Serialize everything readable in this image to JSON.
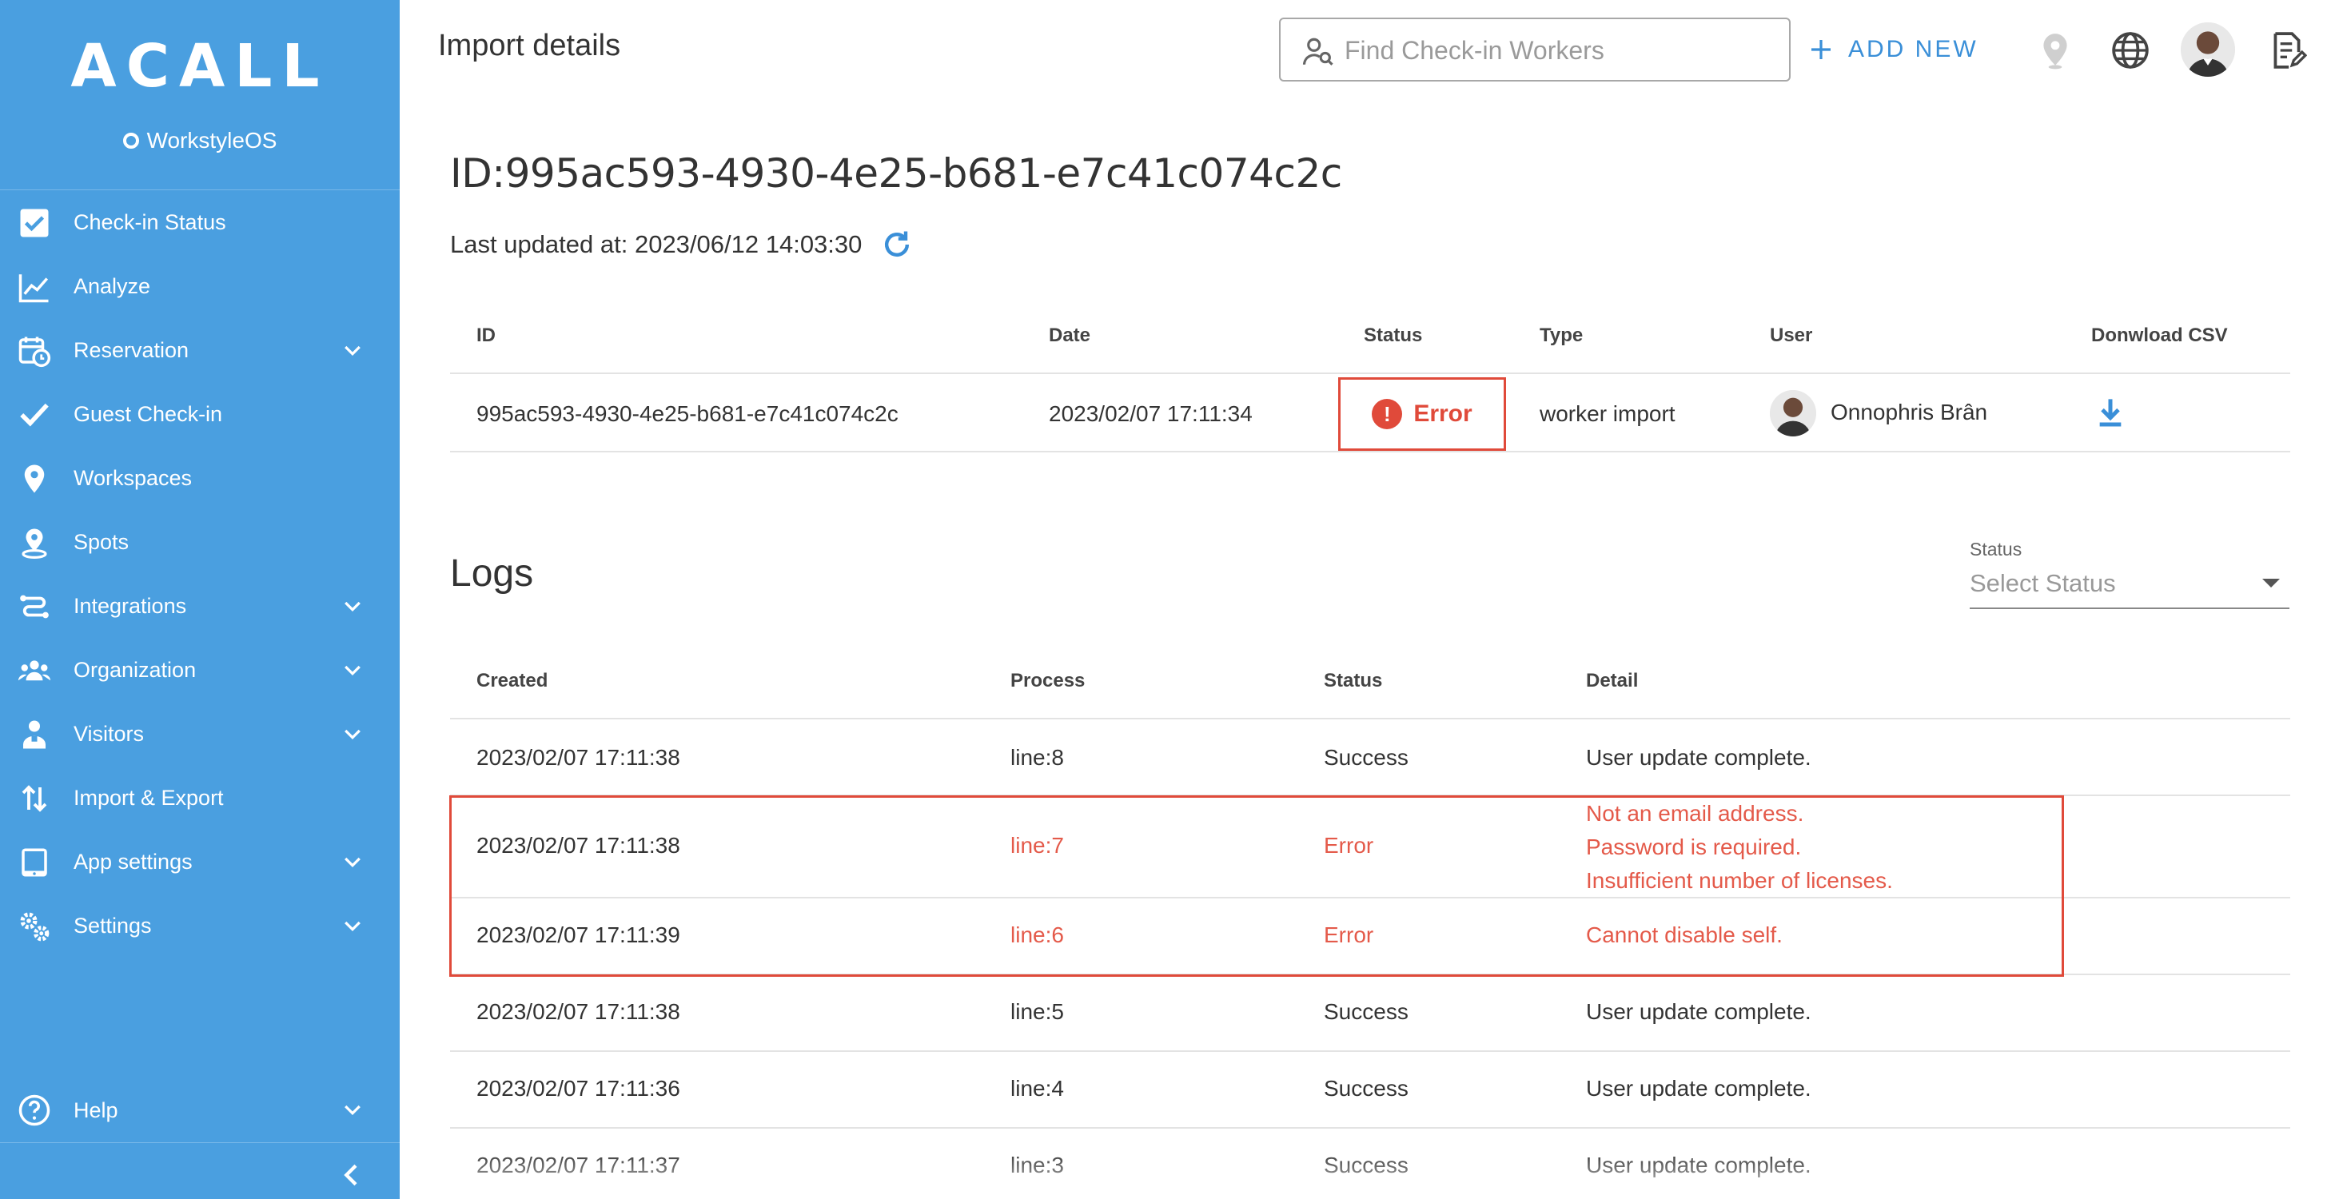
{
  "brand": {
    "logo": "ACALL",
    "subtitle": "WorkstyleOS"
  },
  "sidebar": {
    "items": [
      {
        "label": "Check-in Status",
        "icon": "checkbox-icon",
        "has_chevron": false
      },
      {
        "label": "Analyze",
        "icon": "line-chart-icon",
        "has_chevron": false
      },
      {
        "label": "Reservation",
        "icon": "calendar-clock-icon",
        "has_chevron": true
      },
      {
        "label": "Guest Check-in",
        "icon": "check-icon",
        "has_chevron": false
      },
      {
        "label": "Workspaces",
        "icon": "map-pin-icon",
        "has_chevron": false
      },
      {
        "label": "Spots",
        "icon": "spot-pin-icon",
        "has_chevron": false
      },
      {
        "label": "Integrations",
        "icon": "integrations-icon",
        "has_chevron": true
      },
      {
        "label": "Organization",
        "icon": "people-group-icon",
        "has_chevron": true
      },
      {
        "label": "Visitors",
        "icon": "visitor-icon",
        "has_chevron": true
      },
      {
        "label": "Import & Export",
        "icon": "import-export-icon",
        "has_chevron": false
      },
      {
        "label": "App settings",
        "icon": "tablet-icon",
        "has_chevron": true
      },
      {
        "label": "Settings",
        "icon": "gears-icon",
        "has_chevron": true
      }
    ],
    "help_label": "Help"
  },
  "header": {
    "title": "Import details",
    "search_placeholder": "Find Check-in Workers",
    "add_new_label": "ADD NEW"
  },
  "import": {
    "id_line": "ID:995ac593-4930-4e25-b681-e7c41c074c2c",
    "last_updated": "Last updated at: 2023/06/12 14:03:30"
  },
  "details_table": {
    "headers": {
      "id": "ID",
      "date": "Date",
      "status": "Status",
      "type": "Type",
      "user": "User",
      "csv": "Donwload CSV"
    },
    "row": {
      "id": "995ac593-4930-4e25-b681-e7c41c074c2c",
      "date": "2023/02/07 17:11:34",
      "status": "Error",
      "type": "worker import",
      "user": "Onnophris Brân"
    }
  },
  "logs": {
    "title": "Logs",
    "status_filter_label": "Status",
    "status_filter_placeholder": "Select Status",
    "headers": {
      "created": "Created",
      "process": "Process",
      "status": "Status",
      "detail": "Detail"
    },
    "rows": [
      {
        "created": "2023/02/07 17:11:38",
        "process": "line:8",
        "status": "Success",
        "detail": [
          "User update complete."
        ]
      },
      {
        "created": "2023/02/07 17:11:38",
        "process": "line:7",
        "status": "Error",
        "detail": [
          "Not an email address.",
          "Password is required.",
          "Insufficient number of licenses."
        ]
      },
      {
        "created": "2023/02/07 17:11:39",
        "process": "line:6",
        "status": "Error",
        "detail": [
          "Cannot disable self."
        ]
      },
      {
        "created": "2023/02/07 17:11:38",
        "process": "line:5",
        "status": "Success",
        "detail": [
          "User update complete."
        ]
      },
      {
        "created": "2023/02/07 17:11:36",
        "process": "line:4",
        "status": "Success",
        "detail": [
          "User update complete."
        ]
      },
      {
        "created": "2023/02/07 17:11:37",
        "process": "line:3",
        "status": "Success",
        "detail": [
          "User update complete."
        ]
      }
    ]
  },
  "colors": {
    "sidebar": "#4a9fe0",
    "accent": "#3a8fd8",
    "error": "#e04a3a"
  }
}
